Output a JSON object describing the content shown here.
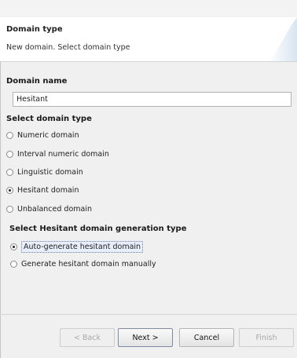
{
  "banner": {
    "title": "Domain type",
    "message": "New domain. Select domain type"
  },
  "domain_name": {
    "label": "Domain name",
    "value": "Hesitant"
  },
  "domain_type": {
    "label": "Select domain type",
    "options": [
      {
        "label": "Numeric domain",
        "selected": false
      },
      {
        "label": "Interval numeric domain",
        "selected": false
      },
      {
        "label": "Linguistic domain",
        "selected": false
      },
      {
        "label": "Hesitant domain",
        "selected": true
      },
      {
        "label": "Unbalanced domain",
        "selected": false
      }
    ]
  },
  "generation": {
    "label": "Select Hesitant domain generation type",
    "options": [
      {
        "label": "Auto-generate hesitant domain",
        "selected": true
      },
      {
        "label": "Generate hesitant domain manually",
        "selected": false
      }
    ]
  },
  "buttons": {
    "back": "< Back",
    "next": "Next >",
    "cancel": "Cancel",
    "finish": "Finish"
  }
}
